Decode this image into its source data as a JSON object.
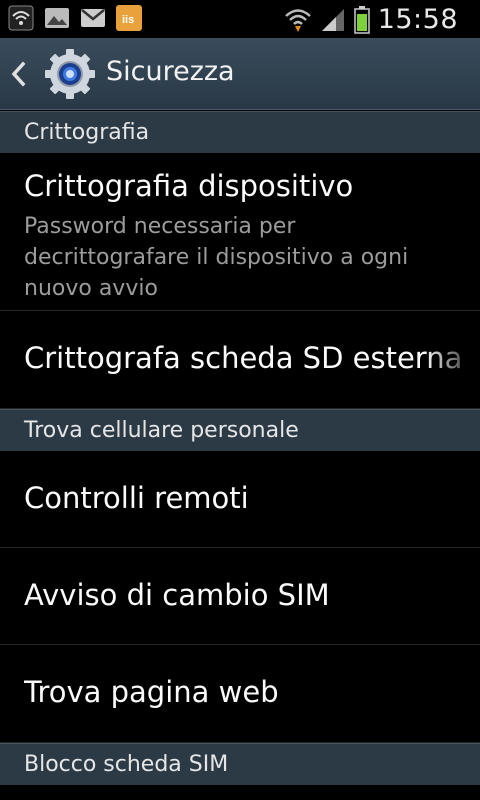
{
  "status_bar": {
    "time": "15:58",
    "notification_icons": [
      "wifi-icon",
      "gallery-icon",
      "gmail-icon",
      "app-icon"
    ],
    "status_icons": [
      "wifi-signal-icon",
      "cell-signal-icon",
      "battery-icon"
    ],
    "app_badge": "iis"
  },
  "action_bar": {
    "title": "Sicurezza",
    "icon": "gear-icon",
    "back_icon": "chevron-left-icon"
  },
  "sections": [
    {
      "header": "Crittografia"
    },
    {
      "header": "Trova cellulare personale"
    },
    {
      "header": "Blocco scheda SIM"
    }
  ],
  "items": [
    {
      "title": "Crittografia dispositivo",
      "summary": "Password necessaria per decrittografare il dispositivo a ogni nuovo avvio"
    },
    {
      "title": "Crittografa scheda SD esterna"
    },
    {
      "title": "Controlli remoti"
    },
    {
      "title": "Avviso di cambio SIM"
    },
    {
      "title": "Trova pagina web"
    }
  ],
  "colors": {
    "action_bar": "#2f3f4d",
    "section_header": "#2c3a46",
    "background": "#000000",
    "summary_text": "#9c9c9c"
  }
}
